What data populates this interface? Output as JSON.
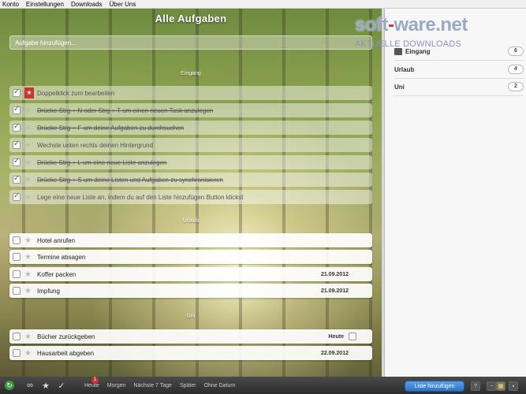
{
  "menu": [
    "Konto",
    "Einstellungen",
    "Downloads",
    "Über Uns"
  ],
  "main": {
    "title": "Alle Aufgaben",
    "add_placeholder": "Aufgabe hinzufügen..."
  },
  "sections": [
    {
      "label": "Eingang",
      "tasks": [
        {
          "text": "Doppelklick zum bearbeiten",
          "done": true,
          "starred": true,
          "date": ""
        },
        {
          "text": "Drücke Strg + N oder Strg + T um einen neuen Task anzulegen",
          "done": true,
          "starred": false,
          "date": ""
        },
        {
          "text": "Drücke Strg + F um deine Aufgaben zu durchsuchen",
          "done": true,
          "starred": false,
          "date": ""
        },
        {
          "text": "Wechsle unten rechts deinen Hintergrund",
          "done": true,
          "starred": false,
          "date": ""
        },
        {
          "text": "Drücke Strg + L um eine neue Liste anzulegen",
          "done": true,
          "starred": false,
          "date": ""
        },
        {
          "text": "Drücke Strg + S um deine Listen und Aufgaben zu synchronisieren",
          "done": true,
          "starred": false,
          "date": ""
        },
        {
          "text": "Lege eine neue Liste an, indem du auf den Liste hinzufügen Button klickst",
          "done": true,
          "starred": false,
          "date": ""
        }
      ]
    },
    {
      "label": "Urlaub",
      "tasks": [
        {
          "text": "Hotel anrufen",
          "done": false,
          "starred": false,
          "date": ""
        },
        {
          "text": "Termine absagen",
          "done": false,
          "starred": false,
          "date": ""
        },
        {
          "text": "Koffer packen",
          "done": false,
          "starred": false,
          "date": "21.09.2012"
        },
        {
          "text": "Impfung",
          "done": false,
          "starred": false,
          "date": "21.09.2012"
        }
      ]
    },
    {
      "label": "Uni",
      "tasks": [
        {
          "text": "Bücher zurückgeben",
          "done": false,
          "starred": false,
          "date": "Heute"
        },
        {
          "text": "Hausarbeit abgeben",
          "done": false,
          "starred": false,
          "date": "22.09.2012"
        }
      ]
    }
  ],
  "watermark": {
    "brand": "soft",
    "dash": "-",
    "brand2": "ware.net",
    "sub": "AKTUELLE DOWNLOADS"
  },
  "sidebar": {
    "lists": [
      {
        "name": "Eingang",
        "count": "6"
      },
      {
        "name": "Urlaub",
        "count": "4"
      },
      {
        "name": "Uni",
        "count": "2"
      }
    ]
  },
  "bottombar": {
    "tabs": [
      "Heute",
      "Morgen",
      "Nächste 7 Tage",
      "Später",
      "Ohne Datum"
    ],
    "heute_badge": "1",
    "add_list_label": "Liste hinzufügen",
    "help_label": "?"
  },
  "colors": {
    "accent": "#2f74c8",
    "star": "#cc3333"
  }
}
